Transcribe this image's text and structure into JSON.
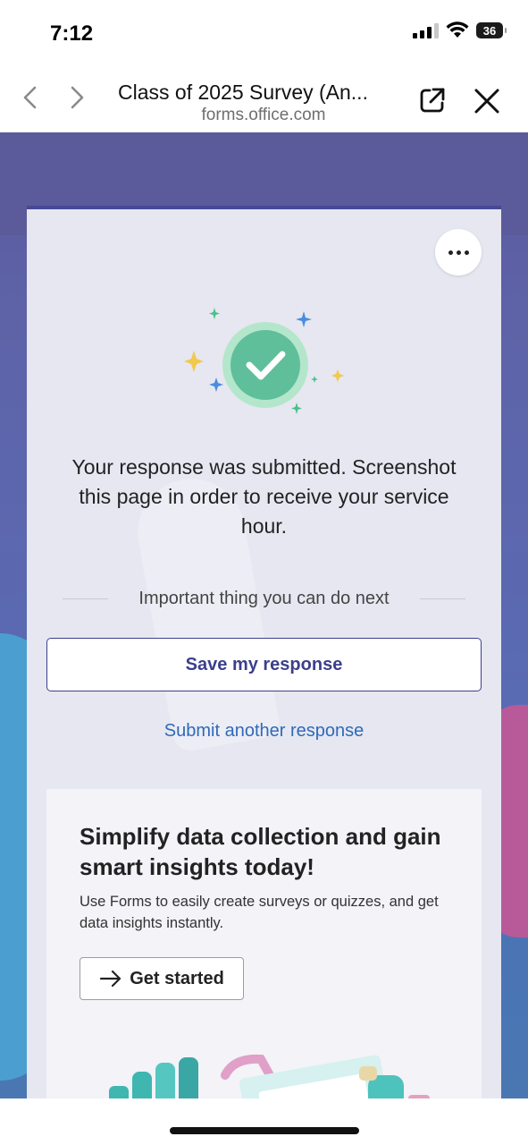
{
  "status_bar": {
    "time": "7:12",
    "battery": "36"
  },
  "browser": {
    "title": "Class of 2025 Survey (An...",
    "url": "forms.office.com"
  },
  "form": {
    "submitted_message": "Your response was submitted. Screenshot this page in order to receive your service hour.",
    "next_label": "Important thing you can do next",
    "save_button": "Save my response",
    "submit_another": "Submit another response"
  },
  "promo": {
    "title": "Simplify data collection and gain smart insights today!",
    "description": "Use Forms to easily create surveys or quizzes, and get data insights instantly.",
    "cta": "Get started"
  },
  "colors": {
    "brand": "#464a95",
    "link": "#2f6ab8",
    "success": "#5cc49a"
  }
}
